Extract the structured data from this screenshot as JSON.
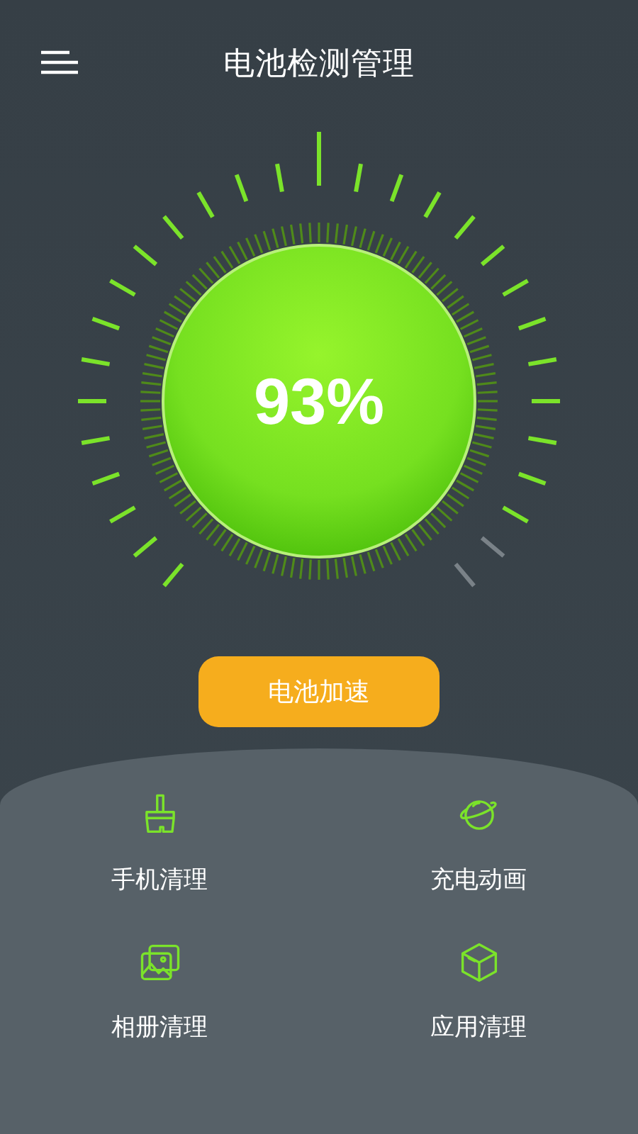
{
  "header": {
    "title": "电池检测管理"
  },
  "battery": {
    "reading": "93%",
    "level": 0.93
  },
  "boost_button": {
    "label": "电池加速"
  },
  "features": [
    {
      "kind": "broom",
      "label": "手机清理"
    },
    {
      "kind": "planet",
      "label": "充电动画"
    },
    {
      "kind": "gallery",
      "label": "相册清理"
    },
    {
      "kind": "box",
      "label": "应用清理"
    }
  ]
}
